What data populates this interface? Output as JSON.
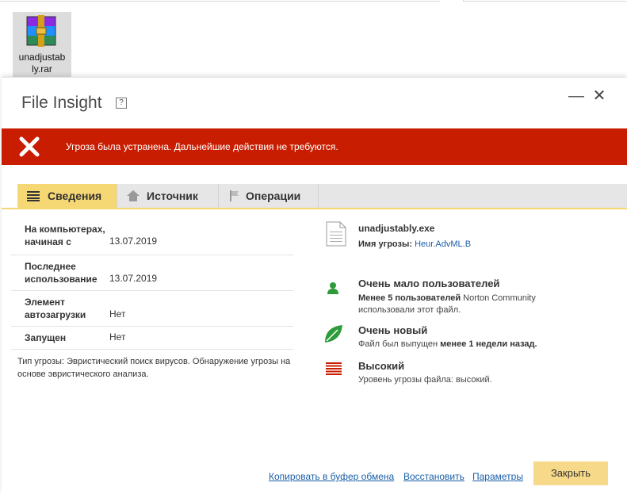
{
  "desktop": {
    "file_icon_name": "winrar-archive-icon",
    "file_label_line1": "unadjustab",
    "file_label_line2": "ly.rar"
  },
  "dialog": {
    "title": "File Insight",
    "help": "?",
    "minimize": "—",
    "close": "✕"
  },
  "banner": {
    "text": "Угроза была устранена. Дальнейшие действия не требуются.",
    "color": "#c81d00"
  },
  "tabs": [
    {
      "label": "Сведения",
      "icon": "list-icon"
    },
    {
      "label": "Источник",
      "icon": "home-icon"
    },
    {
      "label": "Операции",
      "icon": "flag-icon"
    }
  ],
  "details": [
    {
      "label": "На компьютерах, начиная с",
      "value": "13.07.2019"
    },
    {
      "label": "Последнее использование",
      "value": "13.07.2019"
    },
    {
      "label": "Элемент автозагрузки",
      "value": "Нет"
    },
    {
      "label": "Запущен",
      "value": "Нет"
    }
  ],
  "threat_note": "Тип угрозы: Эвристический поиск вирусов. Обнаружение угрозы на основе эвристического анализа.",
  "file": {
    "name": "unadjustably.exe",
    "threat_label": "Имя угрозы:",
    "threat_name": "Heur.AdvML.B"
  },
  "insights": {
    "users_title": "Очень мало пользователей",
    "users_bold": "Менее 5 пользователей",
    "users_rest": " Norton Community",
    "users_line2": "использовали этот файл.",
    "age_title": "Очень новый",
    "age_text": "Файл был выпущен ",
    "age_bold": "менее 1 недели назад.",
    "risk_title": "Высокий",
    "risk_text": "Уровень угрозы файла: высокий."
  },
  "footer": {
    "copy": "Копировать в буфер обмена",
    "restore": "Восстановить",
    "params": "Параметры",
    "close": "Закрыть"
  },
  "colors": {
    "accent": "#f5d774",
    "danger": "#c81d00",
    "link": "#1b5fa8",
    "green": "#2e9b3a"
  }
}
